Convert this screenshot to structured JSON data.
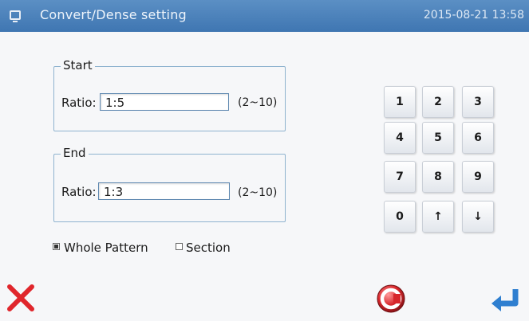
{
  "titlebar": {
    "title": "Convert/Dense setting",
    "datetime": "2015-08-21 13:58"
  },
  "start_group": {
    "legend": "Start",
    "ratio_label": "Ratio:",
    "ratio_value": "1:5",
    "range": "(2~10)"
  },
  "end_group": {
    "legend": "End",
    "ratio_label": "Ratio:",
    "ratio_value": "1:3",
    "range": "(2~10)"
  },
  "keypad": {
    "keys": [
      "1",
      "2",
      "3",
      "4",
      "5",
      "6",
      "7",
      "8",
      "9",
      "0",
      "↑",
      "↓"
    ]
  },
  "options": {
    "whole_pattern": {
      "label": "Whole Pattern",
      "checked": true
    },
    "section": {
      "label": "Section",
      "checked": false
    }
  },
  "icons": {
    "cancel": "close-icon",
    "clear": "clear-icon",
    "confirm": "enter-icon"
  },
  "colors": {
    "titlebar": "#4a7fb9",
    "cancel_red": "#e0262c",
    "confirm_blue": "#2f7fd0"
  }
}
